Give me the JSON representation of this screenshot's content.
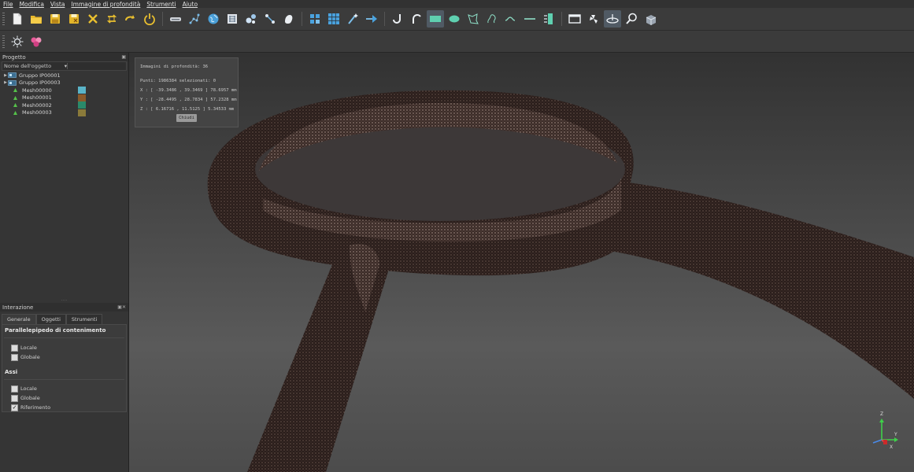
{
  "menu": [
    "File",
    "Modifica",
    "Vista",
    "Immagine di profondità",
    "Strumenti",
    "Aiuto"
  ],
  "toolbar": {
    "row1_icons": [
      "new-file-icon",
      "open-folder-icon",
      "save-icon",
      "save-as-icon",
      "delete-icon",
      "swap-icon",
      "redo-icon",
      "power-icon",
      "scanner-icon",
      "points-icon",
      "globe-icon",
      "texture-icon",
      "spheres-icon",
      "connect-icon",
      "shape-icon",
      "grid-small-icon",
      "grid-large-icon",
      "wand-icon",
      "arrow-plane-icon",
      "hook-icon",
      "curve-icon",
      "rectangle-icon",
      "ellipse-icon",
      "polygon-icon",
      "freeform-icon",
      "line-wave-icon",
      "line-icon",
      "layers-icon",
      "window-icon",
      "fan-icon",
      "plane-select-icon",
      "magnify-icon",
      "cube-icon"
    ],
    "row2_icons": [
      "sun-light-icon",
      "color-balls-icon"
    ]
  },
  "project_panel": {
    "title": "Progetto",
    "header_name": "Nome dell'oggetto",
    "items": [
      {
        "label": "Gruppo IP00001",
        "type": "group"
      },
      {
        "label": "Gruppo IP00003",
        "type": "group"
      },
      {
        "label": "Mesh00000",
        "type": "mesh",
        "color": "#5ab4c8"
      },
      {
        "label": "Mesh00001",
        "type": "mesh",
        "color": "#8a5a2a"
      },
      {
        "label": "Mesh00002",
        "type": "mesh",
        "color": "#2a8a6a"
      },
      {
        "label": "Mesh00003",
        "type": "mesh",
        "color": "#8a7a3a"
      }
    ]
  },
  "interaction_panel": {
    "title": "Interazione",
    "tabs": [
      "Generale",
      "Oggetti",
      "Strumenti"
    ],
    "bbox_title": "Parallelepipedo di contenimento",
    "bbox_options": [
      {
        "label": "Locale",
        "checked": false
      },
      {
        "label": "Globale",
        "checked": false
      }
    ],
    "axes_title": "Assi",
    "axes_options": [
      {
        "label": "Locale",
        "checked": false
      },
      {
        "label": "Globale",
        "checked": false
      },
      {
        "label": "Riferimento",
        "checked": true
      }
    ]
  },
  "info_box": {
    "title": "Immagini di profondità: 36",
    "points": "Punti:    1986384  selezionati:  0",
    "x": "X : [ -39.3486 , 39.3469 ]  78.6957 mm",
    "y": "Y : [ -28.4495 , 28.7834 ]  57.2328 mm",
    "z": "Z : [  6.16716 , 11.5125 ]  5.34533 mm",
    "close": "Chiudi"
  },
  "axis_labels": {
    "z": "Z",
    "y": "Y",
    "x": "X"
  }
}
